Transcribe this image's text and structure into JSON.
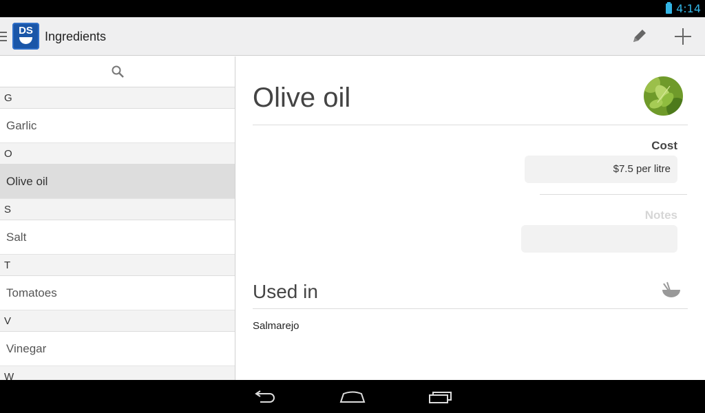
{
  "status_bar": {
    "time": "4:14"
  },
  "action_bar": {
    "logo_text": "DS",
    "title": "Ingredients",
    "edit_icon": "pencil-icon",
    "add_icon": "plus-icon"
  },
  "list": {
    "search_icon": "search-icon",
    "sections": [
      {
        "header": "G",
        "items": [
          "Garlic"
        ]
      },
      {
        "header": "O",
        "items": [
          "Olive oil"
        ]
      },
      {
        "header": "S",
        "items": [
          "Salt"
        ]
      },
      {
        "header": "T",
        "items": [
          "Tomatoes"
        ]
      },
      {
        "header": "V",
        "items": [
          "Vinegar"
        ]
      },
      {
        "header": "W",
        "items": []
      }
    ],
    "selected": "Olive oil"
  },
  "detail": {
    "title": "Olive oil",
    "cost_label": "Cost",
    "cost_value": "$7.5 per litre",
    "notes_label": "Notes",
    "notes_value": "",
    "used_in_title": "Used in",
    "used_in": [
      "Salmarejo"
    ]
  },
  "colors": {
    "accent": "#33b5e5",
    "notes_label": "#d6d6d6",
    "selected_row": "#dddddd"
  }
}
